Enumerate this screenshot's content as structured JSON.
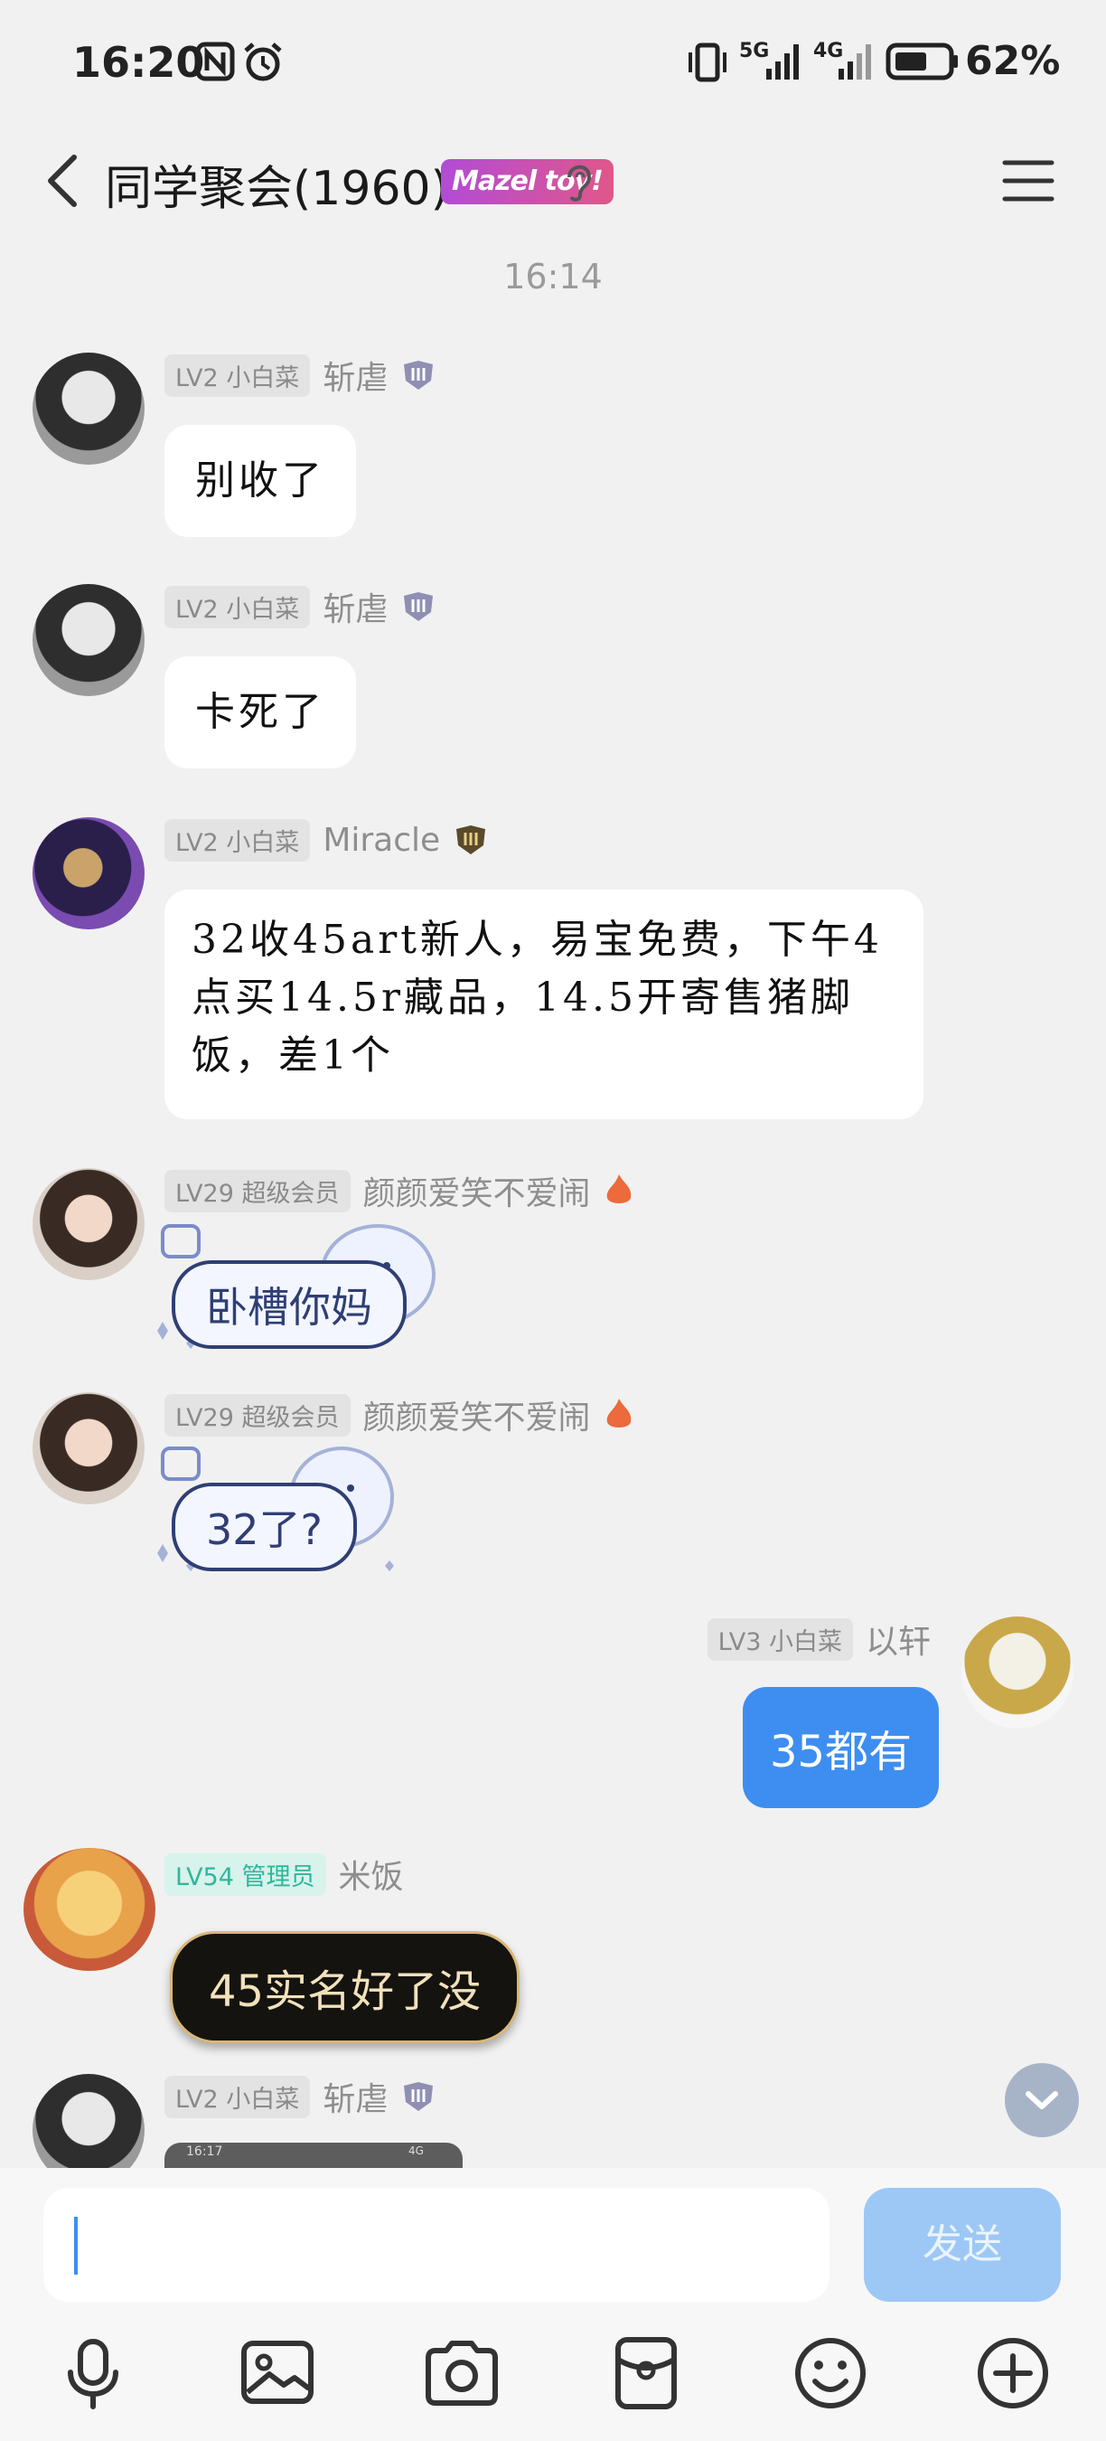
{
  "status_bar": {
    "time": "16:20",
    "network_labels": [
      "5G",
      "4G"
    ],
    "battery": "62%"
  },
  "header": {
    "title": "同学聚会(1960)",
    "badge": "Mazel tov!"
  },
  "timestamp": "16:14",
  "messages": [
    {
      "level": "LV2 小白菜",
      "sender": "斩虐",
      "text": "别收了",
      "type": "text"
    },
    {
      "level": "LV2 小白菜",
      "sender": "斩虐",
      "text": "卡死了",
      "type": "text"
    },
    {
      "level": "LV2 小白菜",
      "sender": "Miracle",
      "text": " 32收45art新人，易宝免费，下午4点买14.5r藏品，14.5开寄售猪脚饭，差1个",
      "type": "text"
    },
    {
      "level": "LV29 超级会员",
      "sender": "颜颜爱笑不爱闹",
      "text": "卧槽你妈",
      "type": "cloud"
    },
    {
      "level": "LV29 超级会员",
      "sender": "颜颜爱笑不爱闹",
      "text": "32了?",
      "type": "cloud"
    },
    {
      "level": "LV3 小白菜",
      "sender": "以轩",
      "text": "35都有",
      "type": "self"
    },
    {
      "level": "LV54 管理员",
      "sender": "米饭",
      "text": "45实名好了没",
      "type": "dark"
    },
    {
      "level": "LV2 小白菜",
      "sender": "斩虐",
      "text": "",
      "type": "screenshot"
    }
  ],
  "preview_screenshot": {
    "time": "16:17",
    "status": "4G"
  },
  "input": {
    "value": "",
    "send_label": "发送"
  },
  "toolbar": [
    "microphone-icon",
    "image-icon",
    "camera-icon",
    "red-packet-icon",
    "emoji-icon",
    "plus-icon"
  ],
  "colors": {
    "accent": "#3d8ef0",
    "send_disabled": "#9dc8f5",
    "admin_tag": "#2fb79b"
  }
}
